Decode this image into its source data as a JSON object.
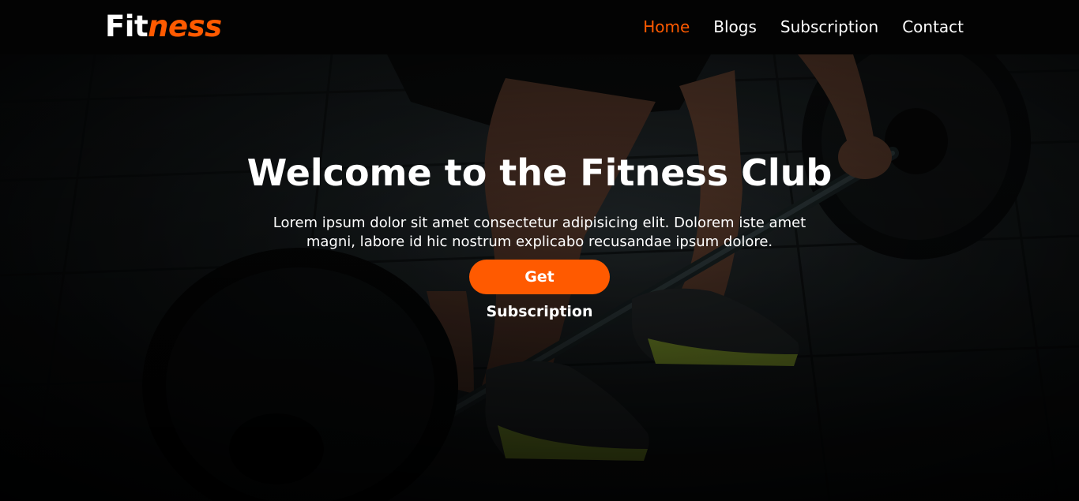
{
  "navbar": {
    "logo": {
      "part1": "Fit",
      "part2": "ness"
    },
    "links": [
      {
        "label": "Home",
        "active": true
      },
      {
        "label": "Blogs",
        "active": false
      },
      {
        "label": "Subscription",
        "active": false
      },
      {
        "label": "Contact",
        "active": false
      }
    ]
  },
  "hero": {
    "title": "Welcome to the Fitness Club",
    "text": "Lorem ipsum dolor sit amet consectetur adipisicing elit. Dolorem iste amet magni, labore id hic nostrum explicabo recusandae ipsum dolore.",
    "button_label": "Get Subscription"
  },
  "colors": {
    "accent": "#ff5a00",
    "navbar_bg": "#030303",
    "text": "#ffffff"
  }
}
